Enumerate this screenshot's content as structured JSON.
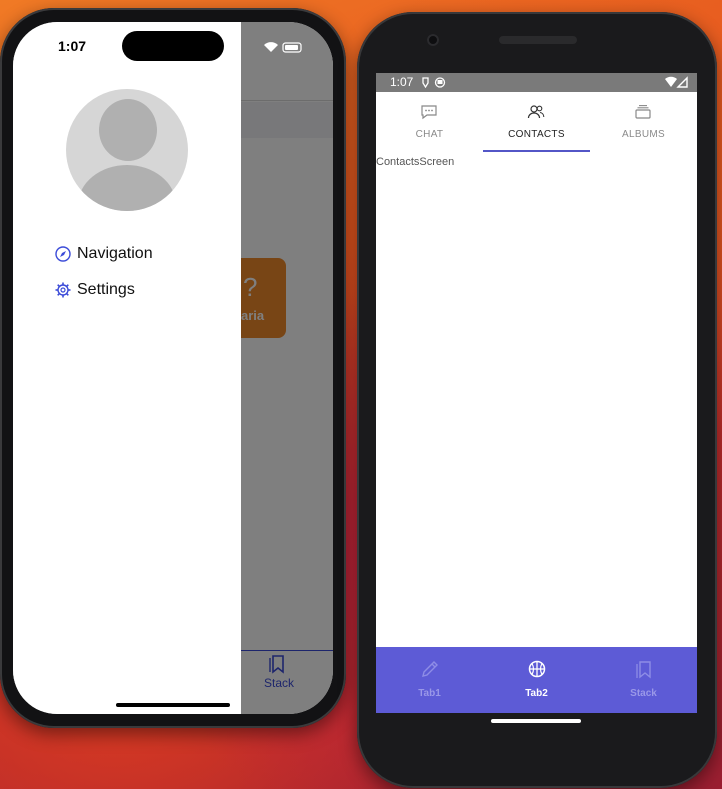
{
  "ios": {
    "status_time": "1:07",
    "drawer": {
      "items": [
        {
          "label": "Navigation",
          "icon": "compass-icon"
        },
        {
          "label": "Settings",
          "icon": "gear-icon"
        }
      ]
    },
    "background_app": {
      "card_text": "aria",
      "card_glyph": "?",
      "tab_label": "Stack"
    }
  },
  "android": {
    "status_time": "1:07",
    "top_tabs": [
      {
        "label": "CHAT",
        "icon": "chat-icon",
        "selected": false
      },
      {
        "label": "CONTACTS",
        "icon": "contacts-icon",
        "selected": true
      },
      {
        "label": "ALBUMS",
        "icon": "albums-icon",
        "selected": false
      }
    ],
    "screen_text": "ContactsScreen",
    "bottom_tabs": [
      {
        "label": "Tab1",
        "icon": "pencil-icon",
        "selected": false
      },
      {
        "label": "Tab2",
        "icon": "basketball-icon",
        "selected": true
      },
      {
        "label": "Stack",
        "icon": "bookmarks-icon",
        "selected": false
      }
    ]
  },
  "colors": {
    "accent": "#5356c7",
    "bottom_bar": "#5d5bd6",
    "ios_accent": "#3b4bd8",
    "orange_card": "#f08a2a"
  }
}
